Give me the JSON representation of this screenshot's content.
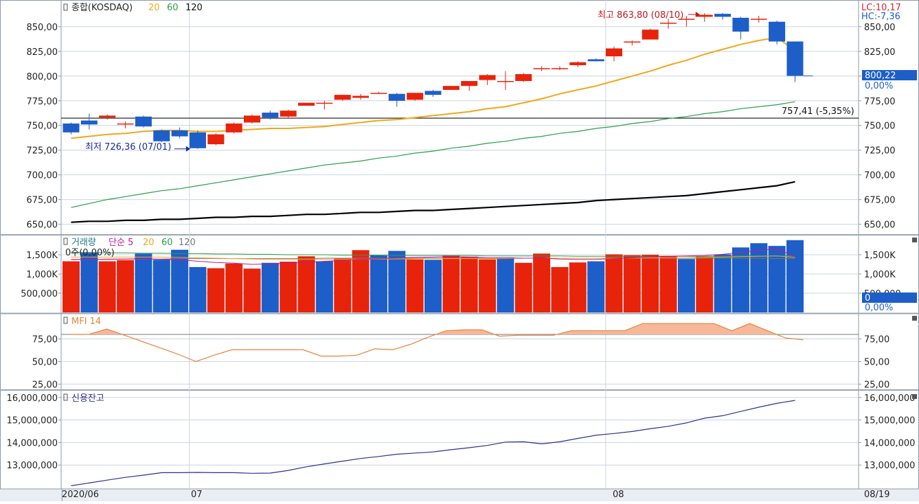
{
  "colors": {
    "up": "#e8230c",
    "down": "#1d5ec9",
    "ma20": "#f0a818",
    "ma60": "#2a9d4a",
    "ma120": "#000000",
    "mfi": "#e8823a",
    "mfi_fill": "#f7b89a",
    "credit": "#2b2f8f",
    "grid": "#c8d4e0",
    "frame": "#8a98a8",
    "lc": "#d9262c",
    "hc": "#1d5ec9",
    "current_box": "#1d5ec9"
  },
  "chart_data": [
    {
      "panel": "price",
      "type": "candlestick",
      "title": "종합(KOSDAQ)",
      "legend": [
        "20",
        "60",
        "120"
      ],
      "ylim": [
        640,
        877
      ],
      "yticks": [
        650,
        675,
        700,
        725,
        750,
        775,
        800,
        825,
        850
      ],
      "ytick_labels": [
        "650,00",
        "675,00",
        "700,00",
        "725,00",
        "750,00",
        "775,00",
        "800,00",
        "825,00",
        "850,00"
      ],
      "candles": [
        [
          752,
          753,
          741,
          743
        ],
        [
          755,
          762,
          746,
          751
        ],
        [
          758,
          761,
          756,
          760
        ],
        [
          751,
          754,
          747,
          752
        ],
        [
          759,
          760,
          748,
          749
        ],
        [
          745,
          746,
          733,
          734
        ],
        [
          745,
          748,
          737,
          739
        ],
        [
          743,
          745,
          726.36,
          727
        ],
        [
          731,
          742,
          730,
          741
        ],
        [
          743,
          753,
          742,
          752
        ],
        [
          753,
          761,
          752,
          760
        ],
        [
          763,
          765,
          756,
          758
        ],
        [
          759,
          766,
          758,
          765
        ],
        [
          770,
          773,
          770,
          773
        ],
        [
          773,
          775,
          766,
          773
        ],
        [
          776,
          781,
          775,
          781
        ],
        [
          778,
          782,
          776,
          780
        ],
        [
          783,
          784,
          782,
          783
        ],
        [
          782,
          783,
          769,
          775
        ],
        [
          776,
          783,
          775,
          783
        ],
        [
          785,
          786,
          779,
          781
        ],
        [
          786,
          790,
          786,
          790
        ],
        [
          790,
          795,
          785,
          795
        ],
        [
          796,
          802,
          791,
          801
        ],
        [
          795,
          805,
          786,
          795
        ],
        [
          795,
          803,
          794,
          802
        ],
        [
          808,
          810,
          805,
          808
        ],
        [
          808,
          810,
          806,
          808
        ],
        [
          811,
          815,
          809,
          814
        ],
        [
          817,
          818,
          815,
          815
        ],
        [
          820,
          830,
          815,
          828
        ],
        [
          834,
          836,
          831,
          835
        ],
        [
          837,
          848,
          837,
          847
        ],
        [
          854,
          858,
          848,
          854
        ],
        [
          858,
          861,
          850,
          858
        ],
        [
          860,
          863.8,
          855,
          862
        ],
        [
          863,
          864,
          857,
          860
        ],
        [
          859,
          860,
          837,
          845
        ],
        [
          858,
          861,
          854,
          858
        ],
        [
          855,
          856,
          832,
          835
        ],
        [
          835,
          835,
          794,
          800.22
        ]
      ],
      "ma20": [
        737,
        739,
        741,
        742,
        744,
        745,
        745,
        744,
        744,
        745,
        746,
        747,
        747,
        748,
        749,
        751,
        753,
        755,
        756,
        758,
        760,
        762,
        764,
        767,
        769,
        773,
        777,
        782,
        786,
        790,
        795,
        800,
        805,
        811,
        816,
        822,
        827,
        832,
        836,
        839,
        826
      ],
      "ma60": [
        667,
        671,
        675,
        678,
        681,
        684,
        686,
        689,
        692,
        695,
        698,
        701,
        704,
        707,
        710,
        712,
        714,
        717,
        719,
        722,
        724,
        727,
        729,
        732,
        734,
        737,
        739,
        742,
        744,
        747,
        749,
        752,
        754,
        757,
        759,
        762,
        764,
        767,
        769,
        771,
        774
      ],
      "ma120": [
        652,
        653,
        653,
        654,
        654,
        655,
        655,
        656,
        657,
        657,
        658,
        658,
        659,
        660,
        660,
        661,
        662,
        662,
        663,
        664,
        664,
        665,
        666,
        667,
        668,
        669,
        670,
        671,
        672,
        674,
        675,
        676,
        677,
        678,
        679,
        681,
        683,
        685,
        687,
        689,
        693
      ],
      "reference_line": 757.41,
      "reference_label": "757,41 (-5,35%)",
      "high_label": "최고 863,80 (08/10)",
      "low_label": "최저 726,36 (07/01)",
      "lc_label": "LC:10,17",
      "hc_label": "HC:-7,36",
      "current_value": "800,22",
      "current_pct": "0,00%"
    },
    {
      "panel": "volume",
      "type": "bar",
      "title": "거래량",
      "legend_prefix": "단순 5",
      "legend": [
        "20",
        "60",
        "120"
      ],
      "subtitle": "0주(0,00%)",
      "ylim": [
        0,
        2000
      ],
      "yticks": [
        500,
        1000,
        1500
      ],
      "ytick_labels": [
        "500,000",
        "1,000K",
        "1,500K"
      ],
      "values": [
        1330,
        1550,
        1330,
        1360,
        1530,
        1370,
        1630,
        1180,
        1150,
        1270,
        1140,
        1290,
        1320,
        1460,
        1330,
        1400,
        1620,
        1490,
        1600,
        1380,
        1370,
        1480,
        1450,
        1380,
        1430,
        1290,
        1530,
        1180,
        1300,
        1330,
        1510,
        1490,
        1500,
        1470,
        1390,
        1450,
        1510,
        1690,
        1800,
        1730,
        1880
      ],
      "up": [
        1,
        0,
        1,
        1,
        0,
        0,
        0,
        0,
        1,
        1,
        1,
        0,
        1,
        1,
        0,
        1,
        1,
        0,
        0,
        1,
        0,
        1,
        1,
        1,
        0,
        1,
        1,
        1,
        1,
        0,
        1,
        1,
        1,
        1,
        0,
        1,
        0,
        0,
        0,
        0,
        0
      ],
      "ma5": [
        1380,
        1380,
        1380,
        1390,
        1400,
        1380,
        1370,
        1330,
        1300,
        1280,
        1250,
        1260,
        1280,
        1300,
        1330,
        1350,
        1380,
        1400,
        1420,
        1430,
        1440,
        1450,
        1440,
        1420,
        1420,
        1410,
        1410,
        1390,
        1380,
        1380,
        1400,
        1420,
        1450,
        1460,
        1470,
        1480,
        1510,
        1560,
        1610,
        1660,
        1450
      ],
      "ma20": [
        1440,
        1440,
        1440,
        1440,
        1440,
        1440,
        1430,
        1420,
        1410,
        1400,
        1390,
        1380,
        1380,
        1380,
        1380,
        1380,
        1380,
        1390,
        1390,
        1400,
        1400,
        1400,
        1400,
        1400,
        1400,
        1410,
        1410,
        1410,
        1410,
        1410,
        1410,
        1410,
        1420,
        1420,
        1420,
        1430,
        1440,
        1450,
        1460,
        1470,
        1430
      ],
      "ma60": [
        1560,
        1560,
        1550,
        1550,
        1540,
        1540,
        1530,
        1530,
        1520,
        1520,
        1510,
        1510,
        1500,
        1500,
        1500,
        1490,
        1490,
        1490,
        1480,
        1480,
        1480,
        1480,
        1480,
        1470,
        1470,
        1470,
        1470,
        1470,
        1460,
        1460,
        1460,
        1460,
        1460,
        1460,
        1460,
        1460,
        1460,
        1470,
        1470,
        1470,
        1470
      ],
      "ma120": [
        1380,
        1380,
        1390,
        1390,
        1390,
        1390,
        1400,
        1400,
        1400,
        1400,
        1400,
        1400,
        1400,
        1400,
        1410,
        1410,
        1410,
        1410,
        1410,
        1410,
        1410,
        1410,
        1410,
        1410,
        1410,
        1410,
        1410,
        1410,
        1410,
        1410,
        1410,
        1410,
        1410,
        1410,
        1410,
        1410,
        1410,
        1410,
        1410,
        1400,
        1400
      ],
      "current_value": "0",
      "current_pct": "0,00%"
    },
    {
      "panel": "mfi",
      "type": "line",
      "title": "MFI 14",
      "ylim": [
        20,
        102
      ],
      "yticks": [
        25,
        50,
        75
      ],
      "ytick_labels": [
        "25,00",
        "50,00",
        "75,00"
      ],
      "reference_line": 80,
      "values": [
        80,
        80,
        86,
        79,
        72,
        65,
        58,
        50,
        57,
        63,
        63,
        63,
        63,
        63,
        56,
        56,
        57,
        64,
        63,
        69,
        77,
        84,
        85,
        85,
        78,
        79,
        79,
        79,
        84,
        84,
        84,
        84,
        92,
        92,
        92,
        92,
        92,
        84,
        92,
        84,
        76,
        74
      ]
    },
    {
      "panel": "credit",
      "type": "line",
      "title": "신용잔고",
      "ylim": [
        12000000,
        16270000
      ],
      "yticks": [
        13000000,
        14000000,
        15000000,
        16000000
      ],
      "ytick_labels": [
        "13,000,000",
        "14,000,000",
        "15,000,000",
        "16,000,000"
      ],
      "values": [
        12080000,
        12200000,
        12330000,
        12450000,
        12550000,
        12660000,
        12660000,
        12670000,
        12660000,
        12660000,
        12630000,
        12640000,
        12760000,
        12920000,
        13050000,
        13170000,
        13290000,
        13380000,
        13480000,
        13530000,
        13580000,
        13680000,
        13770000,
        13870000,
        14020000,
        14030000,
        13940000,
        14030000,
        14180000,
        14320000,
        14400000,
        14490000,
        14610000,
        14720000,
        14870000,
        15080000,
        15190000,
        15380000,
        15570000,
        15740000,
        15870000
      ]
    }
  ],
  "xaxis": {
    "labels": [
      "2020/06",
      "07",
      "08"
    ],
    "label_index": [
      0,
      7,
      30
    ],
    "right_label": "08/19"
  }
}
